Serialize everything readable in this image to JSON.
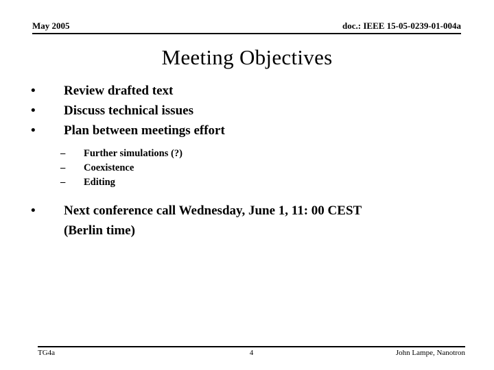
{
  "header": {
    "date": "May 2005",
    "doc_id": "doc.: IEEE 15-05-0239-01-004a"
  },
  "title": "Meeting Objectives",
  "bullets": [
    {
      "marker": "•",
      "text": "Review drafted text"
    },
    {
      "marker": "•",
      "text": "Discuss technical issues"
    },
    {
      "marker": "•",
      "text": "Plan between meetings effort"
    }
  ],
  "sub_bullets": [
    {
      "marker": "–",
      "text": "Further simulations (?)"
    },
    {
      "marker": "–",
      "text": "Coexistence"
    },
    {
      "marker": "–",
      "text": "Editing"
    }
  ],
  "final_bullet": {
    "marker": "•",
    "line1": "Next conference call Wednesday, June 1, 11: 00 CEST",
    "line2": "(Berlin time)"
  },
  "footer": {
    "left": "TG4a",
    "page_number": "4",
    "right": "John Lampe, Nanotron"
  }
}
